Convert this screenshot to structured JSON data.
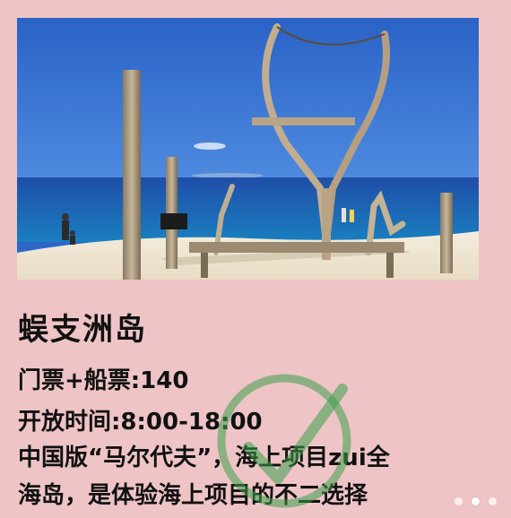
{
  "title": "蜈支洲岛",
  "info": {
    "ticket": "门票+船票:140",
    "hours": "开放时间:8:00-18:00",
    "desc_line1": "中国版“马尔代夫”，海上项目zui全",
    "desc_line2": "海岛，是体验海上项目的不二选择"
  },
  "colors": {
    "background": "#eec4c6",
    "sky": "#2d66c8",
    "sea": "#1f4fa6",
    "sand": "#efe6d3",
    "check_green": "#3aa14a"
  },
  "icons": {
    "watermark": "check-mark-circle-icon"
  },
  "carousel": {
    "count": 3,
    "active_index": 1
  }
}
